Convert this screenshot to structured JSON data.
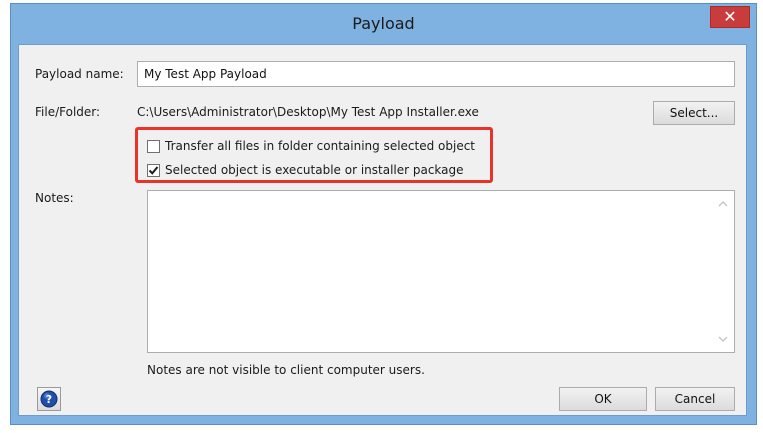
{
  "window": {
    "title": "Payload",
    "close_label": "✕"
  },
  "form": {
    "payload_name_label": "Payload name:",
    "payload_name_value": "My Test App Payload",
    "file_folder_label": "File/Folder:",
    "file_folder_value": "C:\\Users\\Administrator\\Desktop\\My Test App Installer.exe",
    "select_button": "Select...",
    "checkbox_transfer": {
      "label": "Transfer all files in folder containing selected object",
      "checked": false
    },
    "checkbox_executable": {
      "label": "Selected object is executable or installer package",
      "checked": true
    },
    "notes_label": "Notes:",
    "notes_value": "",
    "notes_hint": "Notes are not visible to client computer users."
  },
  "footer": {
    "ok_button": "OK",
    "cancel_button": "Cancel",
    "help_icon": "help-icon"
  },
  "colors": {
    "title_bar": "#7fb2e0",
    "close_button": "#c83c3c",
    "highlight": "#e8322a",
    "help_icon_blue": "#1f4fa8"
  }
}
